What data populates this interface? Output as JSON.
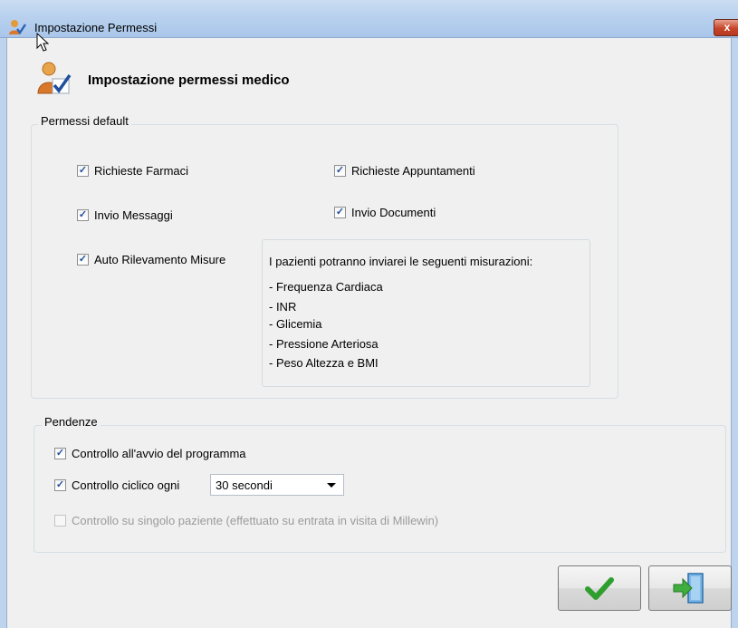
{
  "window": {
    "title": "Impostazione Permessi",
    "close_label": "x",
    "icons": {
      "app": "user-check-icon",
      "close": "close-icon"
    }
  },
  "header": {
    "title": "Impostazione permessi medico",
    "icon": "user-check-icon"
  },
  "permessi_default": {
    "legend": "Permessi default",
    "checkboxes": [
      {
        "label": "Richieste Farmaci",
        "checked": true
      },
      {
        "label": "Richieste Appuntamenti",
        "checked": true
      },
      {
        "label": "Invio Messaggi",
        "checked": true
      },
      {
        "label": "Invio Documenti",
        "checked": true
      },
      {
        "label": "Auto Rilevamento Misure",
        "checked": true
      }
    ],
    "info": {
      "intro": "I pazienti potranno inviarei le seguenti misurazioni:",
      "items": [
        "- Frequenza Cardiaca",
        "- INR",
        "- Glicemia",
        "- Pressione Arteriosa",
        "- Peso Altezza e BMI"
      ]
    }
  },
  "pendenze": {
    "legend": "Pendenze",
    "check_start": {
      "label": "Controllo all'avvio del programma",
      "checked": true
    },
    "check_cyclic": {
      "label": "Controllo ciclico ogni",
      "checked": true
    },
    "interval_select": {
      "value": "30 secondi"
    },
    "check_single": {
      "label": "Controllo su singolo paziente (effettuato su entrata in visita di Millewin)",
      "checked": false,
      "enabled": false
    }
  },
  "buttons": {
    "confirm": {
      "icon": "checkmark-icon",
      "color": "#2e9e2e"
    },
    "exit": {
      "icon": "exit-door-icon",
      "color": "#3c8fd0"
    }
  },
  "colors": {
    "titlebar": "#b9d1ee",
    "background": "#f0f0f0",
    "close": "#c7452a",
    "check": "#1f4f9c"
  }
}
